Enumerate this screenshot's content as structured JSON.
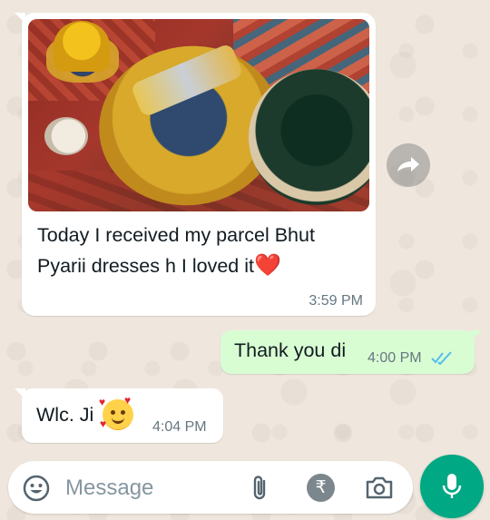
{
  "messages": {
    "incoming_media": {
      "caption_line1": "Today I received my parcel Bhut",
      "caption_line2": "Pyarii dresses h I loved it",
      "emoji": "❤️",
      "time": "3:59 PM",
      "image_icon": "photo-of-deity-dresses"
    },
    "outgoing": {
      "text": "Thank you di",
      "time": "4:00 PM",
      "status_icon": "double-check-icon"
    },
    "incoming_short": {
      "text": "Wlc. Ji",
      "emoji": "smiling-face-with-hearts",
      "time": "4:04 PM"
    }
  },
  "composer": {
    "placeholder": "Message",
    "emoji_icon": "emoji-icon",
    "attach_icon": "paperclip-icon",
    "payment_symbol": "₹",
    "camera_icon": "camera-icon",
    "mic_icon": "mic-icon"
  },
  "colors": {
    "chat_bg": "#efe7dd",
    "incoming_bubble": "#ffffff",
    "outgoing_bubble": "#d9fdd3",
    "accent": "#00a884",
    "read_ticks": "#53bdeb",
    "timestamp": "#667781"
  }
}
